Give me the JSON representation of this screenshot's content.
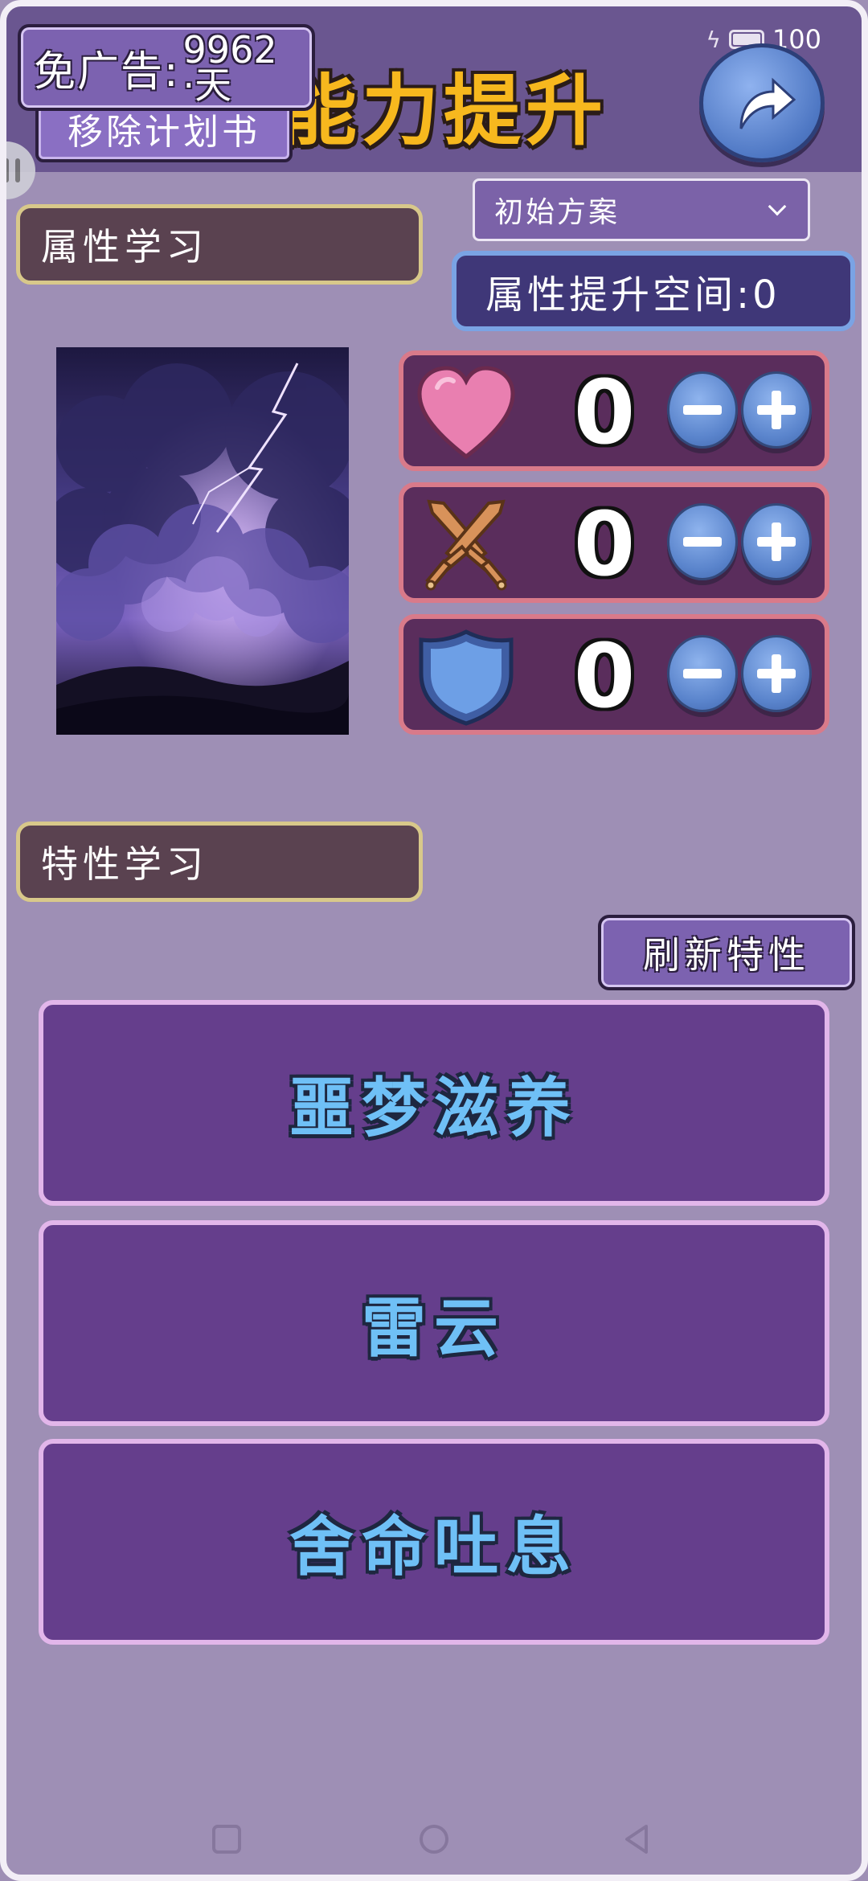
{
  "status_bar": {
    "battery": "100"
  },
  "header": {
    "title": "能力提升",
    "ad_label": "免广告:",
    "ad_days_number": "9962",
    "ad_days_unit": "·天",
    "remove_plan_label": "移除计划书"
  },
  "attributes": {
    "section_title": "属性学习",
    "plan_select_value": "初始方案",
    "points_label": "属性提升空间:0",
    "stats": [
      {
        "name": "health",
        "icon": "heart-icon",
        "value": "0",
        "color": "#e97fb0"
      },
      {
        "name": "attack",
        "icon": "crossed-swords-icon",
        "value": "0",
        "color": "#d8925a"
      },
      {
        "name": "defense",
        "icon": "shield-icon",
        "value": "0",
        "color": "#6d9fe6"
      }
    ]
  },
  "traits": {
    "section_title": "特性学习",
    "refresh_label": "刷新特性",
    "items": [
      "噩梦滋养",
      "雷云",
      "舍命吐息"
    ]
  },
  "colors": {
    "background": "#9e8fb5",
    "header": "#6a5690",
    "title": "#f7b81e",
    "trait_text": "#6fc0f6",
    "trait_card": "#653e8c"
  }
}
